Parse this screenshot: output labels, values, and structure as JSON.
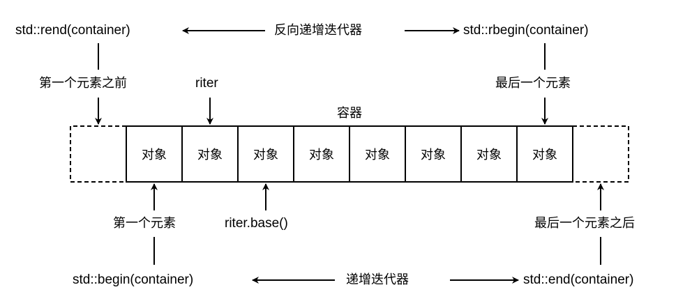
{
  "top": {
    "rend": "std::rend(container)",
    "reverse_iterator": "反向递增迭代器",
    "rbegin": "std::rbegin(container)"
  },
  "labels": {
    "before_first": "第一个元素之前",
    "riter": "riter",
    "last_element": "最后一个元素",
    "container": "容器",
    "first_element": "第一个元素",
    "riter_base": "riter.base()",
    "after_last": "最后一个元素之后"
  },
  "cells": [
    "对象",
    "对象",
    "对象",
    "对象",
    "对象",
    "对象",
    "对象",
    "对象"
  ],
  "bottom": {
    "begin": "std::begin(container)",
    "forward_iterator": "递增迭代器",
    "end": "std::end(container)"
  }
}
